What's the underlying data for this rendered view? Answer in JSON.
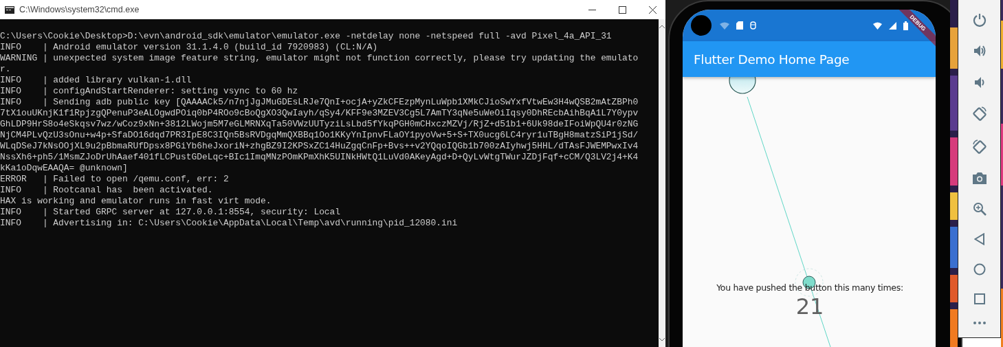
{
  "window": {
    "title": "C:\\Windows\\system32\\cmd.exe"
  },
  "console": {
    "lines": [
      "C:\\Users\\Cookie\\Desktop>D:\\evn\\android_sdk\\emulator\\emulator.exe -netdelay none -netspeed full -avd Pixel_4a_API_31",
      "INFO    | Android emulator version 31.1.4.0 (build_id 7920983) (CL:N/A)",
      "WARNING | unexpected system image feature string, emulator might not function correctly, please try updating the emulato",
      "r.",
      "INFO    | added library vulkan-1.dll",
      "INFO    | configAndStartRenderer: setting vsync to 60 hz",
      "INFO    | Sending adb public key [QAAAACk5/n7njJgJMuGDEsLRJe7QnI+ocjA+yZkCFEzpMynLuWpb1XMkCJioSwYxfVtwEw3H4wQSB2mAtZBPh0",
      "7tX1ouUKnjK1f1RpjzgQPenuP3eALOgwdPOiq0bP4ROo9cBoQgXO3QwIayh/qSy4/KFF9e3MZEV3Cg5L7AmTY3qNe5uWeOiIqsy0DhREcbAihBqA1L7Y0ypv",
      "GhLDP9HrS8o4eSkqsv7wz/wCoz9xNn+3812LWojm5M7eGLMRNXqTa50VWzUUTyziLsLbd5fYkqPGH0mCHxczMZVj/RjZ+d51b1+6Uk98deIFoiWpQU4r0zNG",
      "NjCM4PLvQzU3sOnu+w4p+SfaDO16dqd7PR3IpE8C3IQn5BsRVDgqMmQXBBq1Oo1KKyYnIpnvFLaOY1pyoVw+5+S+TX0ucg6LC4ryr1uTBgH8matzSiP1jSd/",
      "WLqDSeJ7kNsOOjXL9u2pBbmaRUfDpsx8PGiYb6heJxoriN+zhgBZ9I2KPSxZC14HuZgqCnFp+Bvs++v2YQqoIQGb1b700zAIyhwj5HHL/dTAsFJWEMPwxIv4",
      "NssXh6+ph5/1MsmZJoDrUhAaef401fLCPustGDeLqc+BIc1ImqMNzPOmKPmXhK5UINkHWtQ1LuVd0AKeyAgd+D+QyLvWtgTWurJZDjFqf+cCM/Q3LV2j4+K4",
      "kKa1oDqwEAAQA= @unknown]",
      "ERROR   | Failed to open /qemu.conf, err: 2",
      "INFO    | Rootcanal has  been activated.",
      "HAX is working and emulator runs in fast virt mode.",
      "INFO    | Started GRPC server at 127.0.0.1:8554, security: Local",
      "INFO    | Advertising in: C:\\Users\\Cookie\\AppData\\Local\\Temp\\avd\\running\\pid_12080.ini"
    ]
  },
  "emulator": {
    "app_bar": {
      "title": "Flutter Demo Home Page"
    },
    "debug_banner": "DEBUG",
    "counter": {
      "label": "You have pushed the button this many times:",
      "value": "21"
    }
  }
}
